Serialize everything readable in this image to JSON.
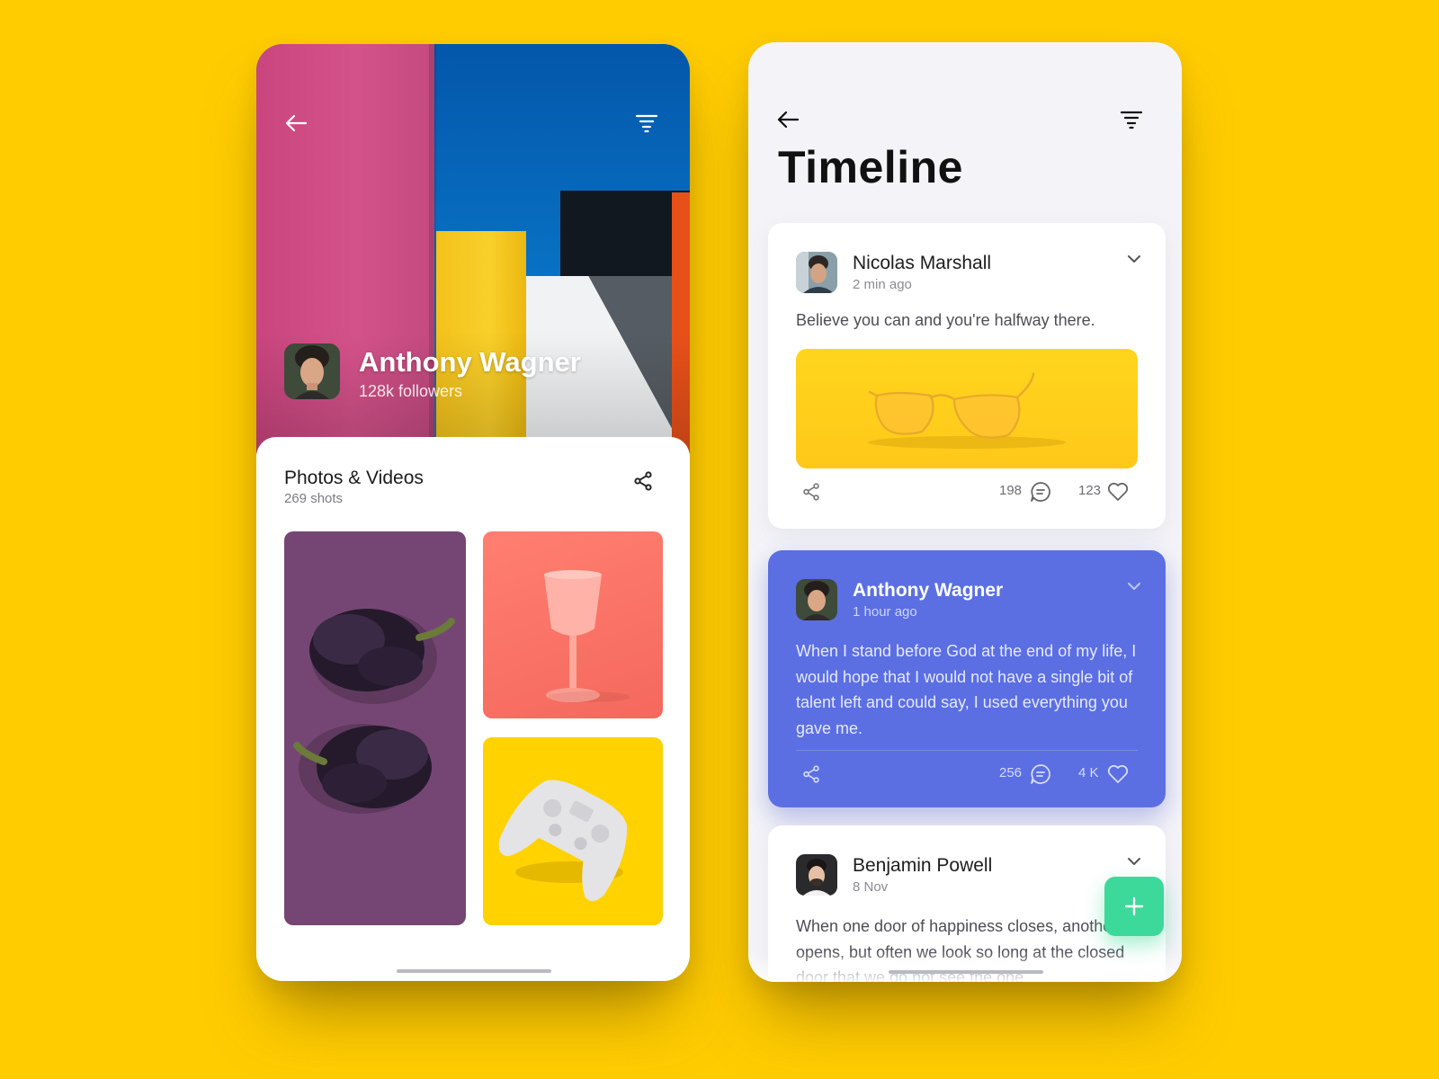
{
  "profile": {
    "name": "Anthony Wagner",
    "followers": "128k followers",
    "gallery": {
      "title": "Photos & Videos",
      "count": "269 shots",
      "tiles": [
        "purple-peppers",
        "pink-wine-glass",
        "white-game-controller"
      ]
    }
  },
  "timeline": {
    "title": "Timeline",
    "posts": [
      {
        "author": "Nicolas Marshall",
        "time": "2 min ago",
        "text": "Believe you can and you're halfway there.",
        "image": "yellow-sunglasses",
        "comments": "198",
        "likes": "123"
      },
      {
        "author": "Anthony Wagner",
        "time": "1 hour ago",
        "text": "When I stand before God at the end of my life, I would hope that I would not have a single bit of talent left and could say, I used everything you gave me.",
        "comments": "256",
        "likes": "4 K"
      },
      {
        "author": "Benjamin Powell",
        "time": "8 Nov",
        "text": "When one door of happiness closes, another opens, but often we look so long at the closed door that we do not see the one"
      }
    ]
  },
  "colors": {
    "background": "#FFCC00",
    "highlight_card": "#5B6FE3",
    "fab": "#3DD99A"
  }
}
